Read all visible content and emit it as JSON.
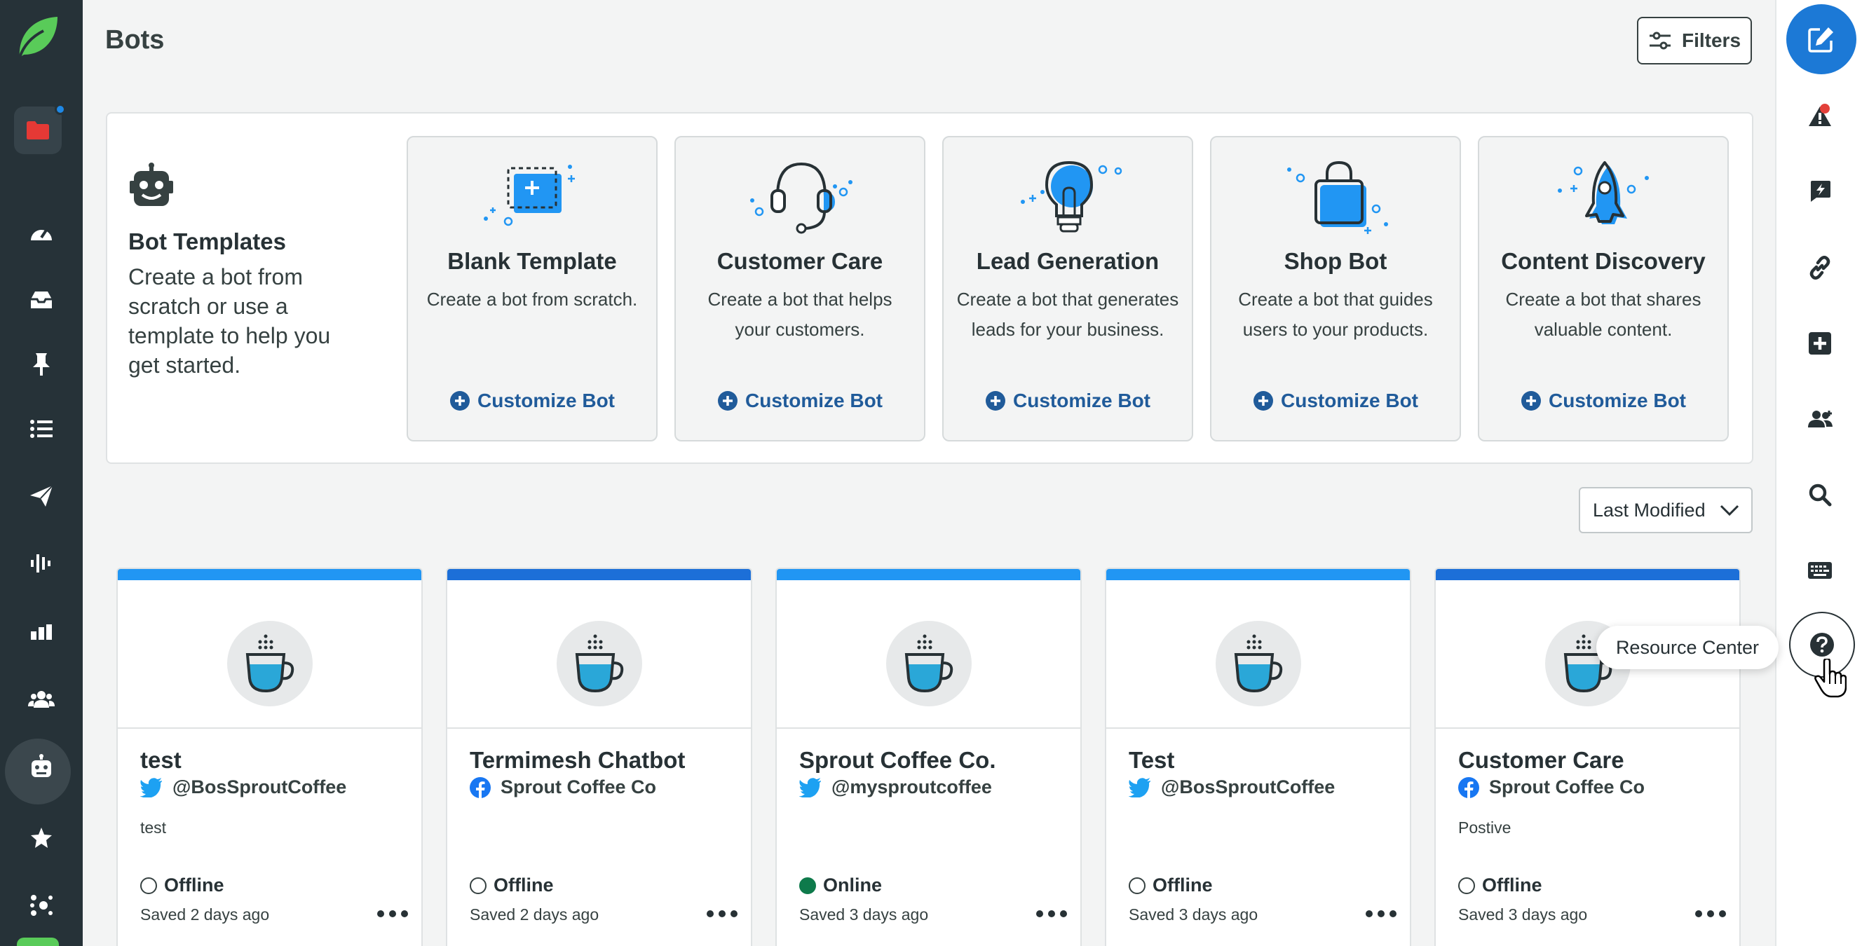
{
  "header": {
    "title": "Bots",
    "filters_label": "Filters"
  },
  "templates": {
    "intro_title": "Bot Templates",
    "intro_text": "Create a bot from scratch or use a template to help you get started.",
    "cards": [
      {
        "title": "Blank Template",
        "description": "Create a bot from scratch.",
        "action": "Customize Bot"
      },
      {
        "title": "Customer Care",
        "description": "Create a bot that helps your customers.",
        "action": "Customize Bot"
      },
      {
        "title": "Lead Generation",
        "description": "Create a bot that generates leads for your business.",
        "action": "Customize Bot"
      },
      {
        "title": "Shop Bot",
        "description": "Create a bot that guides users to your products.",
        "action": "Customize Bot"
      },
      {
        "title": "Content Discovery",
        "description": "Create a bot that shares valuable content.",
        "action": "Customize Bot"
      }
    ]
  },
  "sort": {
    "selected": "Last Modified"
  },
  "bots": [
    {
      "name": "test",
      "network": "twitter",
      "profile": "@BosSproutCoffee",
      "description": "test",
      "status": "Offline",
      "saved": "Saved 2 days ago",
      "bar_color": "#2196f3"
    },
    {
      "name": "Termimesh Chatbot",
      "network": "facebook",
      "profile": "Sprout Coffee Co",
      "description": "",
      "status": "Offline",
      "saved": "Saved 2 days ago",
      "bar_color": "#1c6fd8"
    },
    {
      "name": "Sprout Coffee Co.",
      "network": "twitter",
      "profile": "@mysproutcoffee",
      "description": "",
      "status": "Online",
      "saved": "Saved 3 days ago",
      "bar_color": "#2196f3"
    },
    {
      "name": "Test",
      "network": "twitter",
      "profile": "@BosSproutCoffee",
      "description": "",
      "status": "Offline",
      "saved": "Saved 3 days ago",
      "bar_color": "#2196f3"
    },
    {
      "name": "Customer Care",
      "network": "facebook",
      "profile": "Sprout Coffee Co",
      "description": "Postive",
      "status": "Offline",
      "saved": "Saved 3 days ago",
      "bar_color": "#1c6fd8"
    }
  ],
  "tooltip": {
    "text": "Resource Center"
  },
  "colors": {
    "nav_bg": "#263238",
    "link": "#205b9a",
    "accent": "#1c79d6",
    "online": "#0e7a4b",
    "twitter": "#1da1f2",
    "facebook": "#1877f2"
  },
  "icons": {
    "left_nav": [
      "sprout-logo",
      "folder-icon",
      "gauge-icon",
      "inbox-icon",
      "pin-icon",
      "list-icon",
      "send-icon",
      "listening-icon",
      "reports-icon",
      "people-icon",
      "bot-icon",
      "star-icon",
      "network-icon"
    ],
    "right_rail": [
      "compose-icon",
      "alert-icon",
      "bolt-icon",
      "link-icon",
      "plus-icon",
      "team-icon",
      "search-icon",
      "keyboard-icon",
      "help-icon"
    ]
  }
}
